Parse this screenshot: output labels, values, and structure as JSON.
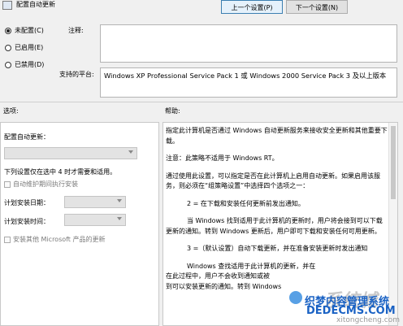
{
  "window": {
    "title": "配置自动更新",
    "prev_button": "上一个设置(P)",
    "next_button": "下一个设置(N)"
  },
  "state": {
    "options": [
      {
        "label": "未配置(C)",
        "selected": true
      },
      {
        "label": "已启用(E)",
        "selected": false
      },
      {
        "label": "已禁用(D)",
        "selected": false
      }
    ]
  },
  "comment": {
    "label": "注释:",
    "value": ""
  },
  "platform": {
    "label": "支持的平台:",
    "value": "Windows XP Professional Service Pack 1 或 Windows 2000 Service Pack 3 及以上版本"
  },
  "sections": {
    "options_label": "选项:",
    "help_label": "帮助:"
  },
  "options_panel": {
    "configure_label": "配置自动更新：",
    "configure_value": "",
    "note": "下列设置仅在选中 4 时才需要和适用。",
    "maintenance_check": "自动维护期间执行安装",
    "maintenance_checked": false,
    "schedule_day_label": "计划安装日期：",
    "schedule_day_value": "",
    "schedule_time_label": "计划安装时间：",
    "schedule_time_value": "",
    "other_products_check": "安装其他 Microsoft 产品的更新",
    "other_products_checked": false
  },
  "help": {
    "paragraphs": [
      "指定此计算机是否通过 Windows 自动更新服务来接收安全更新和其他重要下载。",
      "注意：此策略不适用于 Windows RT。",
      "通过使用此设置，可以指定是否在此计算机上启用自动更新。如果启用该服务，则必须在“组策略设置”中选择四个选项之一：",
      "2 = 在下载和安装任何更新前发出通知。",
      "当 Windows 找到适用于此计算机的更新时，用户将会接到可以下载更新的通知。转到 Windows 更新后，用户即可下载和安装任何可用更新。",
      "3 =（默认设置）自动下载更新，并在准备安装更新时发出通知",
      "Windows 查找适用于此计算机的更新，并在",
      "在此过程中，用户不会收到通知或被",
      "到可以安装更新的通知。转到 Windows"
    ]
  },
  "watermark": {
    "line1": "系统城",
    "line2": "织梦内容管理系统",
    "line3": "DEDECMS.COM",
    "line4": "xitongcheng.com"
  }
}
